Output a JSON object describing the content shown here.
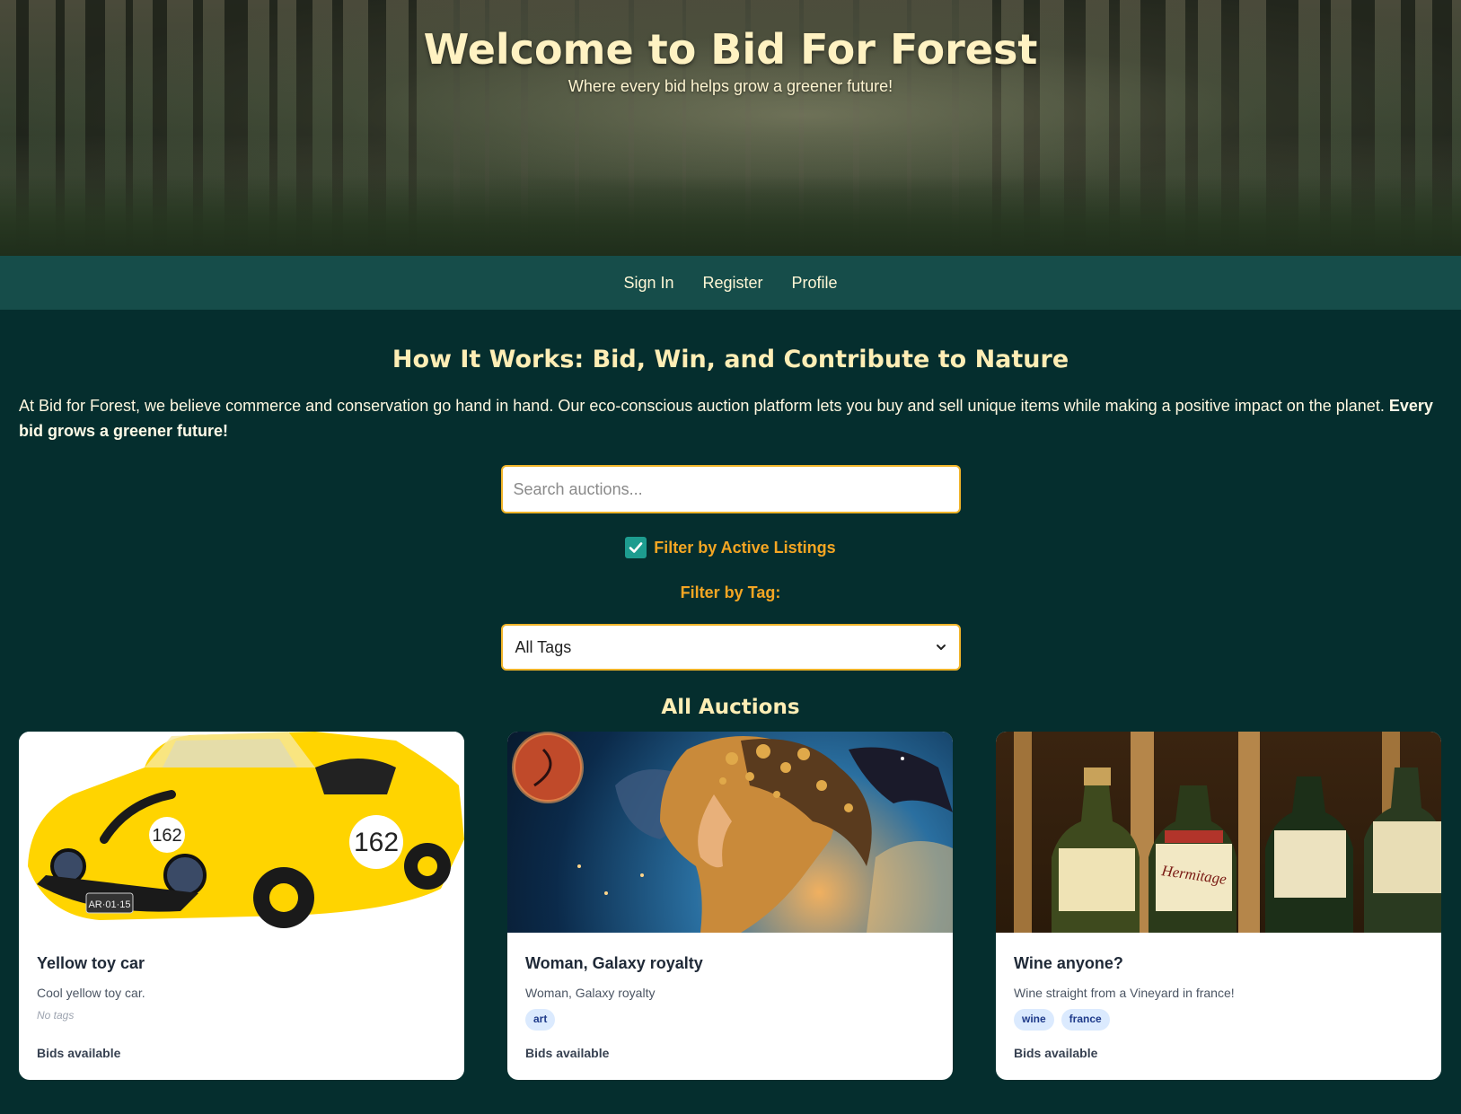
{
  "hero": {
    "title": "Welcome to Bid For Forest",
    "subtitle": "Where every bid helps grow a greener future!"
  },
  "nav": {
    "items": [
      {
        "label": "Sign In"
      },
      {
        "label": "Register"
      },
      {
        "label": "Profile"
      }
    ]
  },
  "intro": {
    "heading": "How It Works: Bid, Win, and Contribute to Nature",
    "text": "At Bid for Forest, we believe commerce and conservation go hand in hand. Our eco-conscious auction platform lets you buy and sell unique items while making a positive impact on the planet. ",
    "emphasis": "Every bid grows a greener future!"
  },
  "search": {
    "placeholder": "Search auctions...",
    "value": ""
  },
  "filters": {
    "active_label": "Filter by Active Listings",
    "active_checked": true,
    "tag_label": "Filter by Tag:",
    "tag_selected": "All Tags"
  },
  "auctions": {
    "heading": "All Auctions",
    "cards": [
      {
        "title": "Yellow toy car",
        "description": "Cool yellow toy car.",
        "no_tags_text": "No tags",
        "tags": [],
        "status": "Bids available",
        "image_icon": "yellow-toy-car-image",
        "plate_text": "AR·01·15",
        "number_text": "162"
      },
      {
        "title": "Woman, Galaxy royalty",
        "description": "Woman, Galaxy royalty",
        "tags": [
          "art"
        ],
        "status": "Bids available",
        "image_icon": "galaxy-woman-image"
      },
      {
        "title": "Wine anyone?",
        "description": "Wine straight from a Vineyard in france!",
        "tags": [
          "wine",
          "france"
        ],
        "status": "Bids available",
        "image_icon": "wine-bottles-image",
        "label_text": "Hermitage"
      }
    ]
  },
  "colors": {
    "background": "#052e2e",
    "nav": "#164d4a",
    "accent": "#f5a623",
    "heading": "#ffeeb5",
    "tag_bg": "#dbeafe"
  }
}
